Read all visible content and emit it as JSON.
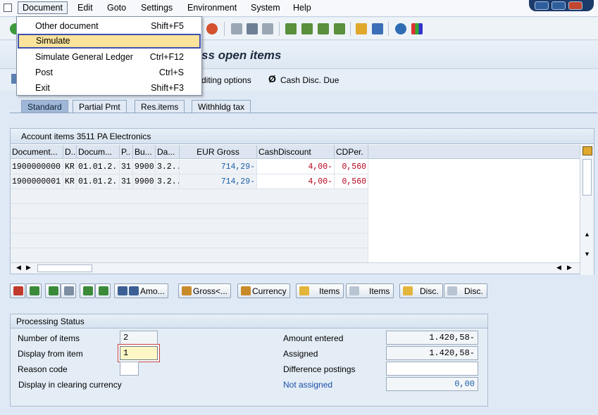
{
  "menubar": {
    "items": [
      "Document",
      "Edit",
      "Goto",
      "Settings",
      "Environment",
      "System",
      "Help"
    ]
  },
  "dropdown": {
    "items": [
      {
        "label": "Other document",
        "shortcut": "Shift+F5"
      },
      {
        "label": "Simulate",
        "shortcut": ""
      },
      {
        "label": "Simulate General Ledger",
        "shortcut": "Ctrl+F12"
      },
      {
        "label": "Post",
        "shortcut": "Ctrl+S"
      },
      {
        "label": "Exit",
        "shortcut": "Shift+F3"
      }
    ]
  },
  "title": {
    "text": "ss open items"
  },
  "apptoolbar": {
    "editing_options": "diting options",
    "cash_disc_due": "Cash Disc. Due"
  },
  "tabs": [
    "Standard",
    "Partial Pmt",
    "Res.items",
    "Withhldg tax"
  ],
  "table": {
    "title": "Account items 3511 PA Electronics",
    "columns": [
      "Document...",
      "D..",
      "Docum...",
      "P..",
      "Bu...",
      "Da...",
      "EUR Gross",
      "CashDiscount",
      "CDPer."
    ],
    "rows": [
      [
        "1900000000",
        "KR",
        "01.01.2...",
        "31",
        "9900",
        "3.2...",
        "714,29-",
        "4,00-",
        "0,560"
      ],
      [
        "1900000001",
        "KR",
        "01.01.2...",
        "31",
        "9900",
        "3.2...",
        "714,29-",
        "4,00-",
        "0,560"
      ]
    ]
  },
  "buttons": {
    "amo": "Amo...",
    "gross": "Gross<...",
    "currency": "Currency",
    "items1": "Items",
    "items2": "Items",
    "disc1": "Disc.",
    "disc2": "Disc."
  },
  "processing": {
    "title": "Processing Status",
    "number_of_items_label": "Number of items",
    "number_of_items_value": "2",
    "display_from_item_label": "Display from item",
    "display_from_item_value": "1",
    "reason_code_label": "Reason code",
    "reason_code_value": "",
    "display_in_clearing_currency_label": "Display in clearing currency",
    "amount_entered_label": "Amount entered",
    "amount_entered_value": "1.420,58-",
    "assigned_label": "Assigned",
    "assigned_value": "1.420,58-",
    "difference_postings_label": "Difference postings",
    "difference_postings_value": "",
    "not_assigned_label": "Not assigned",
    "not_assigned_value": "0,00"
  },
  "colors": {
    "accent": "#3c50b0",
    "highlight": "#fbe39c",
    "link_blue": "#1a4fa8"
  }
}
